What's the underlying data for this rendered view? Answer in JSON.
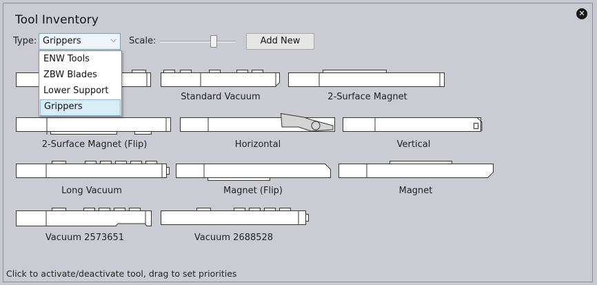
{
  "window": {
    "title": "Tool Inventory",
    "close_glyph": "✕"
  },
  "toolbar": {
    "type_label": "Type:",
    "type_value": "Grippers",
    "type_options": [
      "ENW Tools",
      "ZBW Blades",
      "Lower Support",
      "Grippers"
    ],
    "scale_label": "Scale:",
    "scale_value": 0.73,
    "add_label": "Add New"
  },
  "tools": [
    {
      "name": "Standard Vacuum"
    },
    {
      "name": "2-Surface Magnet"
    },
    {
      "name": "2-Surface Magnet (Flip)"
    },
    {
      "name": "Horizontal"
    },
    {
      "name": "Vertical"
    },
    {
      "name": "Long Vacuum"
    },
    {
      "name": "Magnet (Flip)"
    },
    {
      "name": "Magnet"
    },
    {
      "name": "Vacuum 2573651"
    },
    {
      "name": "Vacuum 2688528"
    }
  ],
  "status": {
    "text": "Click to activate/deactivate tool, drag to set priorities"
  },
  "icons": {
    "close": "close-icon",
    "dropdown": "chevron-down-icon"
  }
}
